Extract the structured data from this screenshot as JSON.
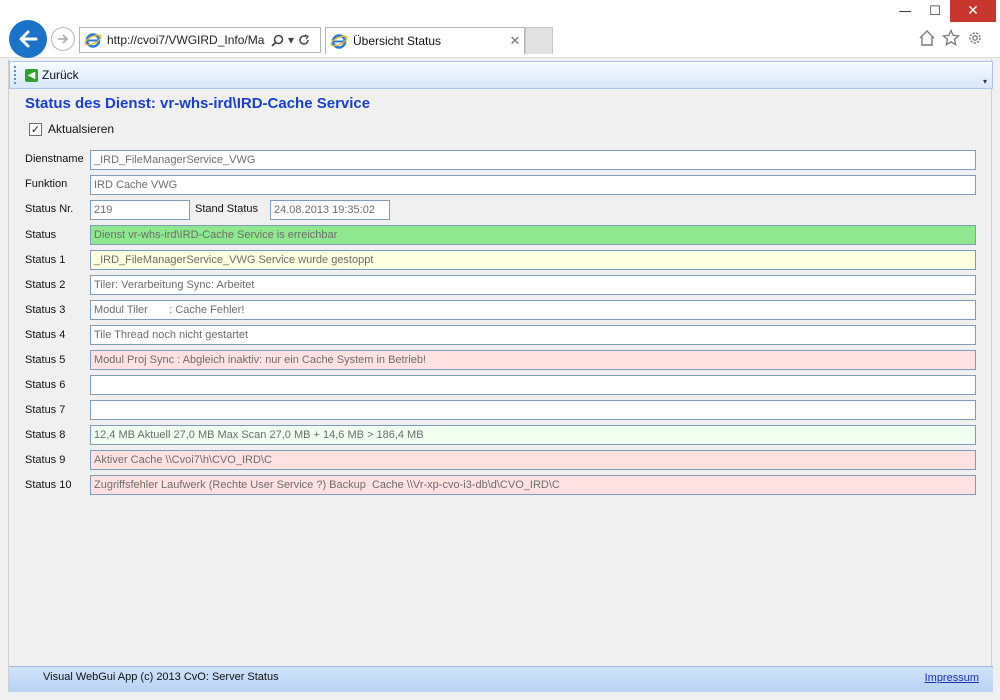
{
  "browser": {
    "address": "http://cvoi7/VWGIRD_Info/Ma",
    "tab_title": "Übersicht Status",
    "window_minimize": "—",
    "window_maximize": "☐",
    "window_close": "✕",
    "tab_close": "✕"
  },
  "toolbar": {
    "back_label": "Zurück"
  },
  "page": {
    "title": "Status des Dienst: vr-whs-ird\\IRD-Cache Service",
    "refresh_label": "Aktualsieren",
    "refresh_checked": true
  },
  "form": {
    "dienstname": {
      "label": "Dienstname",
      "value": "_IRD_FileManagerService_VWG"
    },
    "funktion": {
      "label": "Funktion",
      "value": "IRD Cache VWG"
    },
    "status_nr": {
      "label": "Status Nr.",
      "value": "219"
    },
    "stand_status": {
      "label": "Stand Status",
      "value": "24.08.2013 19:35:02"
    },
    "status": {
      "label": "Status",
      "value": "Dienst vr-whs-ird\\IRD-Cache Service is erreichbar",
      "color": "#8fe88f"
    },
    "status_lines": [
      {
        "label": "Status 1",
        "value": "_IRD_FileManagerService_VWG Service wurde gestoppt",
        "color": "#ffffe0"
      },
      {
        "label": "Status 2",
        "value": "Tiler: Verarbeitung Sync: Arbeitet",
        "color": "#ffffff"
      },
      {
        "label": "Status 3",
        "value": "Modul Tiler       : Cache Fehler!",
        "color": "#ffffff"
      },
      {
        "label": "Status 4",
        "value": "Tile Thread noch nicht gestartet",
        "color": "#ffffff"
      },
      {
        "label": "Status 5",
        "value": "Modul Proj Sync : Abgleich inaktiv: nur ein Cache System in Betrieb!",
        "color": "#ffe1e1"
      },
      {
        "label": "Status 6",
        "value": "",
        "color": "#ffffff"
      },
      {
        "label": "Status 7",
        "value": "",
        "color": "#ffffff"
      },
      {
        "label": "Status 8",
        "value": "12,4 MB Aktuell 27,0 MB Max Scan 27,0 MB + 14,6 MB > 186,4 MB",
        "color": "#f0fff0"
      },
      {
        "label": "Status 9",
        "value": "Aktiver Cache \\\\Cvoi7\\h\\CVO_IRD\\C",
        "color": "#ffe1e1"
      },
      {
        "label": "Status 10",
        "value": "Zugriffsfehler Laufwerk (Rechte User Service ?) Backup  Cache \\\\Vr-xp-cvo-i3-db\\d\\CVO_IRD\\C",
        "color": "#ffe1e1"
      }
    ]
  },
  "footer": {
    "text": "Visual WebGui App (c) 2013 CvO: Server Status",
    "link": "Impressum"
  }
}
